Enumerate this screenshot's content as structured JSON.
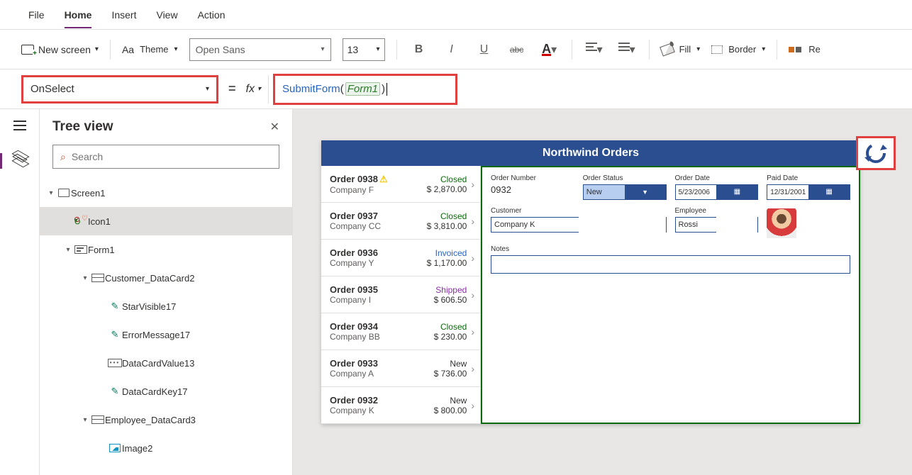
{
  "tabs": {
    "file": "File",
    "home": "Home",
    "insert": "Insert",
    "view": "View",
    "action": "Action"
  },
  "ribbon": {
    "newscreen": "New screen",
    "theme": "Theme",
    "font": "Open Sans",
    "size": "13",
    "fill": "Fill",
    "border": "Border",
    "reorder": "Re"
  },
  "formula": {
    "property": "OnSelect",
    "fn": "SubmitForm",
    "open": "(",
    "arg": "Form1",
    "close": ")"
  },
  "tree": {
    "title": "Tree view",
    "search_placeholder": "Search",
    "nodes": {
      "screen1": "Screen1",
      "icon1": "Icon1",
      "form1": "Form1",
      "customer_card": "Customer_DataCard2",
      "starvisible": "StarVisible17",
      "errormsg": "ErrorMessage17",
      "datacardvalue": "DataCardValue13",
      "datacardkey": "DataCardKey17",
      "employee_card": "Employee_DataCard3",
      "image2": "Image2"
    }
  },
  "app": {
    "title": "Northwind Orders",
    "orders": [
      {
        "num": "Order 0938",
        "company": "Company F",
        "status": "Closed",
        "status_class": "st-closed",
        "amount": "$ 2,870.00",
        "warn": true
      },
      {
        "num": "Order 0937",
        "company": "Company CC",
        "status": "Closed",
        "status_class": "st-closed",
        "amount": "$ 3,810.00"
      },
      {
        "num": "Order 0936",
        "company": "Company Y",
        "status": "Invoiced",
        "status_class": "st-invoiced",
        "amount": "$ 1,170.00"
      },
      {
        "num": "Order 0935",
        "company": "Company I",
        "status": "Shipped",
        "status_class": "st-shipped",
        "amount": "$ 606.50"
      },
      {
        "num": "Order 0934",
        "company": "Company BB",
        "status": "Closed",
        "status_class": "st-closed",
        "amount": "$ 230.00"
      },
      {
        "num": "Order 0933",
        "company": "Company A",
        "status": "New",
        "status_class": "st-new",
        "amount": "$ 736.00"
      },
      {
        "num": "Order 0932",
        "company": "Company K",
        "status": "New",
        "status_class": "st-new",
        "amount": "$ 800.00"
      }
    ],
    "detail": {
      "ordernum_label": "Order Number",
      "ordernum": "0932",
      "orderstatus_label": "Order Status",
      "orderstatus": "New",
      "orderdate_label": "Order Date",
      "orderdate": "5/23/2006",
      "paiddate_label": "Paid Date",
      "paiddate": "12/31/2001",
      "customer_label": "Customer",
      "customer": "Company K",
      "employee_label": "Employee",
      "employee": "Rossi",
      "notes_label": "Notes"
    }
  }
}
